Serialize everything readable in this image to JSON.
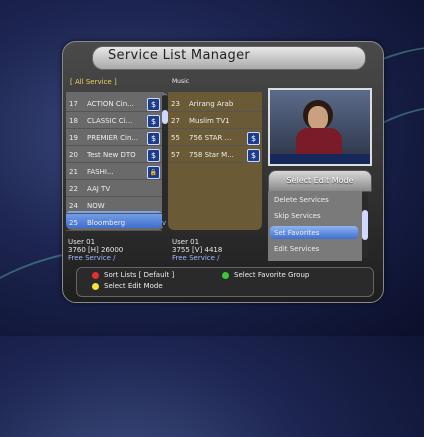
{
  "header": {
    "title": "Service List Manager"
  },
  "tabs": {
    "left": "[ All Service ]",
    "right": "Music"
  },
  "left_list": [
    {
      "num": "17",
      "name": "ACTION Cin...",
      "badge": "$"
    },
    {
      "num": "18",
      "name": "CLASSIC Ci...",
      "badge": "$"
    },
    {
      "num": "19",
      "name": "PREMIER Cin...",
      "badge": "$"
    },
    {
      "num": "20",
      "name": "Test New DTO",
      "badge": "$"
    },
    {
      "num": "21",
      "name": "FASHI...",
      "badge": "lock"
    },
    {
      "num": "22",
      "name": "AAJ TV",
      "badge": ""
    },
    {
      "num": "24",
      "name": "NOW",
      "badge": ""
    },
    {
      "num": "25",
      "name": "Bloomberg",
      "badge": ""
    }
  ],
  "right_list": [
    {
      "num": "23",
      "name": "Arirang Arab",
      "badge": ""
    },
    {
      "num": "27",
      "name": "Muslim TV1",
      "badge": ""
    },
    {
      "num": "55",
      "name": "756 STAR ...",
      "badge": "$"
    },
    {
      "num": "57",
      "name": "758 Star M...",
      "badge": "$"
    }
  ],
  "left_info": {
    "line1": "User 01",
    "line2": "3760 [H] 26000",
    "line3": "Free Service /"
  },
  "right_info": {
    "line1": "User 01",
    "line2": "3755 [V] 4418",
    "line3": "Free Service /"
  },
  "edit_menu": {
    "title": "Select Edit Mode",
    "items": [
      "Delete Services",
      "Skip Services",
      "Set Favorites",
      "Edit Services"
    ],
    "selected_index": 2
  },
  "help": {
    "red": "Sort Lists [ Default ]",
    "green": "Select Favorite Group",
    "yellow": "Select Edit Mode"
  },
  "colors": {
    "red": "#e53030",
    "green": "#3cc63c",
    "yellow": "#f2e23a",
    "selection": "#3e6fcf"
  }
}
